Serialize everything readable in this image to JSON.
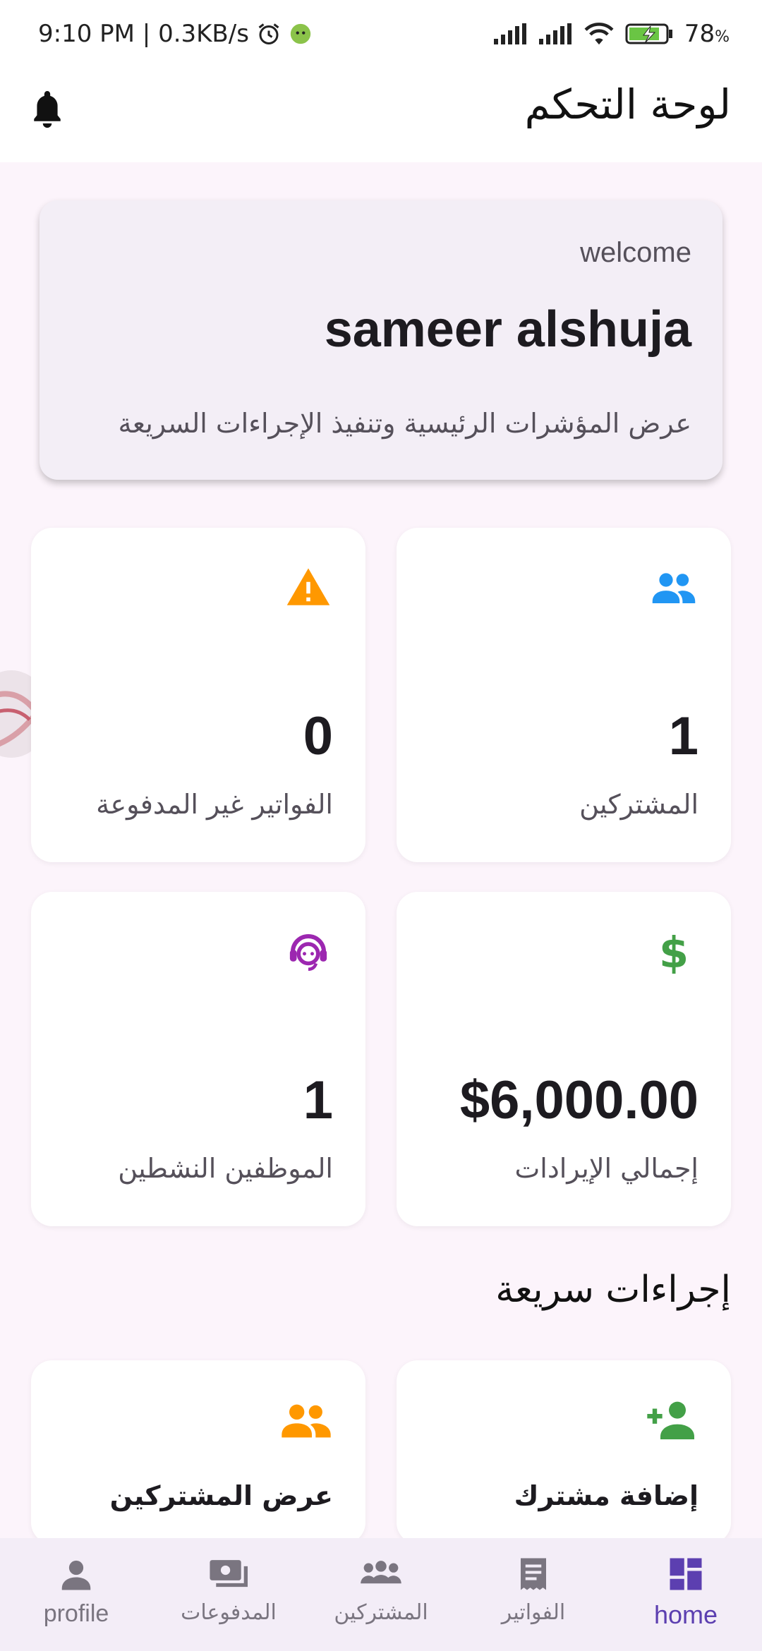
{
  "status_bar": {
    "time_speed": "9:10 PM | 0.3KB/s",
    "battery": "78",
    "battery_unit": "%"
  },
  "app_bar": {
    "title": "لوحة التحكم",
    "bell_icon": "bell-icon"
  },
  "welcome": {
    "greeting": "welcome",
    "name": "sameer alshuja",
    "subtitle": "عرض المؤشرات الرئيسية وتنفيذ الإجراءات السريعة"
  },
  "stats": [
    {
      "value": "1",
      "label": "المشتركين",
      "icon": "people-icon",
      "color": "#2196f3"
    },
    {
      "value": "0",
      "label": "الفواتير غير المدفوعة",
      "icon": "warning-icon",
      "color": "#ff9800"
    },
    {
      "value": "$6,000.00",
      "label": "إجمالي الإيرادات",
      "icon": "dollar-icon",
      "color": "#43a047"
    },
    {
      "value": "1",
      "label": "الموظفين النشطين",
      "icon": "support-agent-icon",
      "color": "#9c27b0"
    }
  ],
  "quick_actions": {
    "title": "إجراءات سريعة",
    "items": [
      {
        "label": "إضافة مشترك",
        "icon": "person-add-icon",
        "color": "#43a047"
      },
      {
        "label": "عرض المشتركين",
        "icon": "group-icon",
        "color": "#ff9800"
      }
    ]
  },
  "bottom_nav": {
    "items": [
      {
        "label": "profile",
        "icon": "person-icon"
      },
      {
        "label": "المدفوعات",
        "icon": "payments-icon"
      },
      {
        "label": "المشتركين",
        "icon": "groups-icon"
      },
      {
        "label": "الفواتير",
        "icon": "receipt-icon"
      },
      {
        "label": "home",
        "icon": "dashboard-icon",
        "active": true
      }
    ]
  },
  "colors": {
    "accent": "#5c3fb0",
    "background": "#fcf4fb"
  }
}
